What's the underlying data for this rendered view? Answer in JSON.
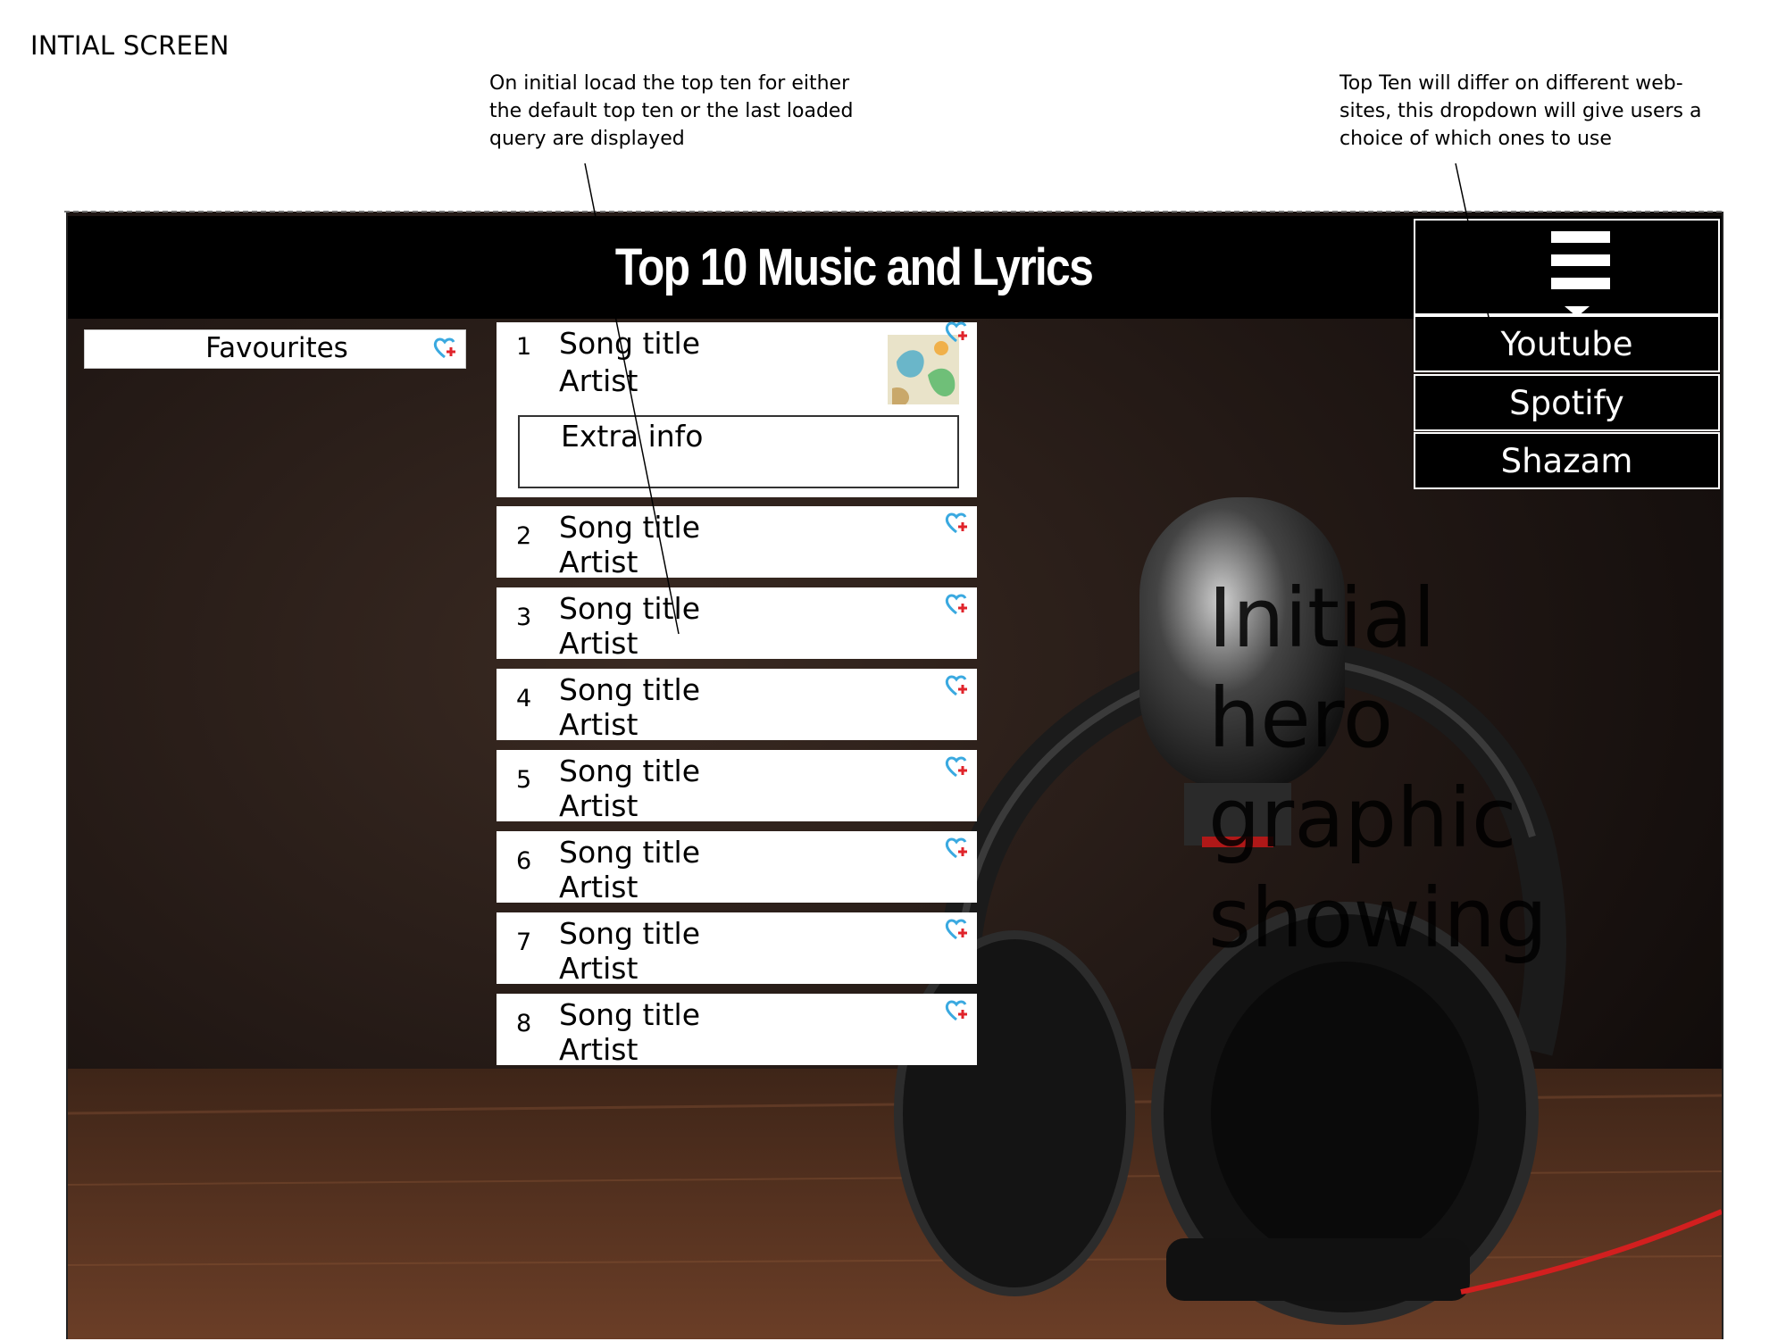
{
  "page": {
    "label": "INTIAL SCREEN",
    "annotations": {
      "left": "On initial locad  the top ten for either\nthe default top ten or the last loaded\nquery are displayed",
      "right": "Top Ten will differ on different web-\nsites, this dropdown will give users a\nchoice of which ones to use"
    }
  },
  "header": {
    "title": "Top 10 Music and Lyrics",
    "menu_icon": "hamburger-icon"
  },
  "dropdown": {
    "items": [
      "Youtube",
      "Spotify",
      "Shazam"
    ]
  },
  "sidebar": {
    "favourites_label": "Favourites",
    "favourites_icon": "heart-plus-icon"
  },
  "songs": [
    {
      "number": "1",
      "title": "Song title",
      "artist": "Artist",
      "extra": "Extra info"
    },
    {
      "number": "2",
      "title": "Song title",
      "artist": "Artist"
    },
    {
      "number": "3",
      "title": "Song title",
      "artist": "Artist"
    },
    {
      "number": "4",
      "title": "Song title",
      "artist": "Artist"
    },
    {
      "number": "5",
      "title": "Song title",
      "artist": "Artist"
    },
    {
      "number": "6",
      "title": "Song title",
      "artist": "Artist"
    },
    {
      "number": "7",
      "title": "Song title",
      "artist": "Artist"
    },
    {
      "number": "8",
      "title": "Song title",
      "artist": "Artist"
    }
  ],
  "hero": {
    "text": "Initial\nhero\ngraphic\nshowing"
  },
  "colors": {
    "header": "#000000",
    "heart_outline": "#3aa9e0",
    "heart_plus": "#e0242b"
  }
}
